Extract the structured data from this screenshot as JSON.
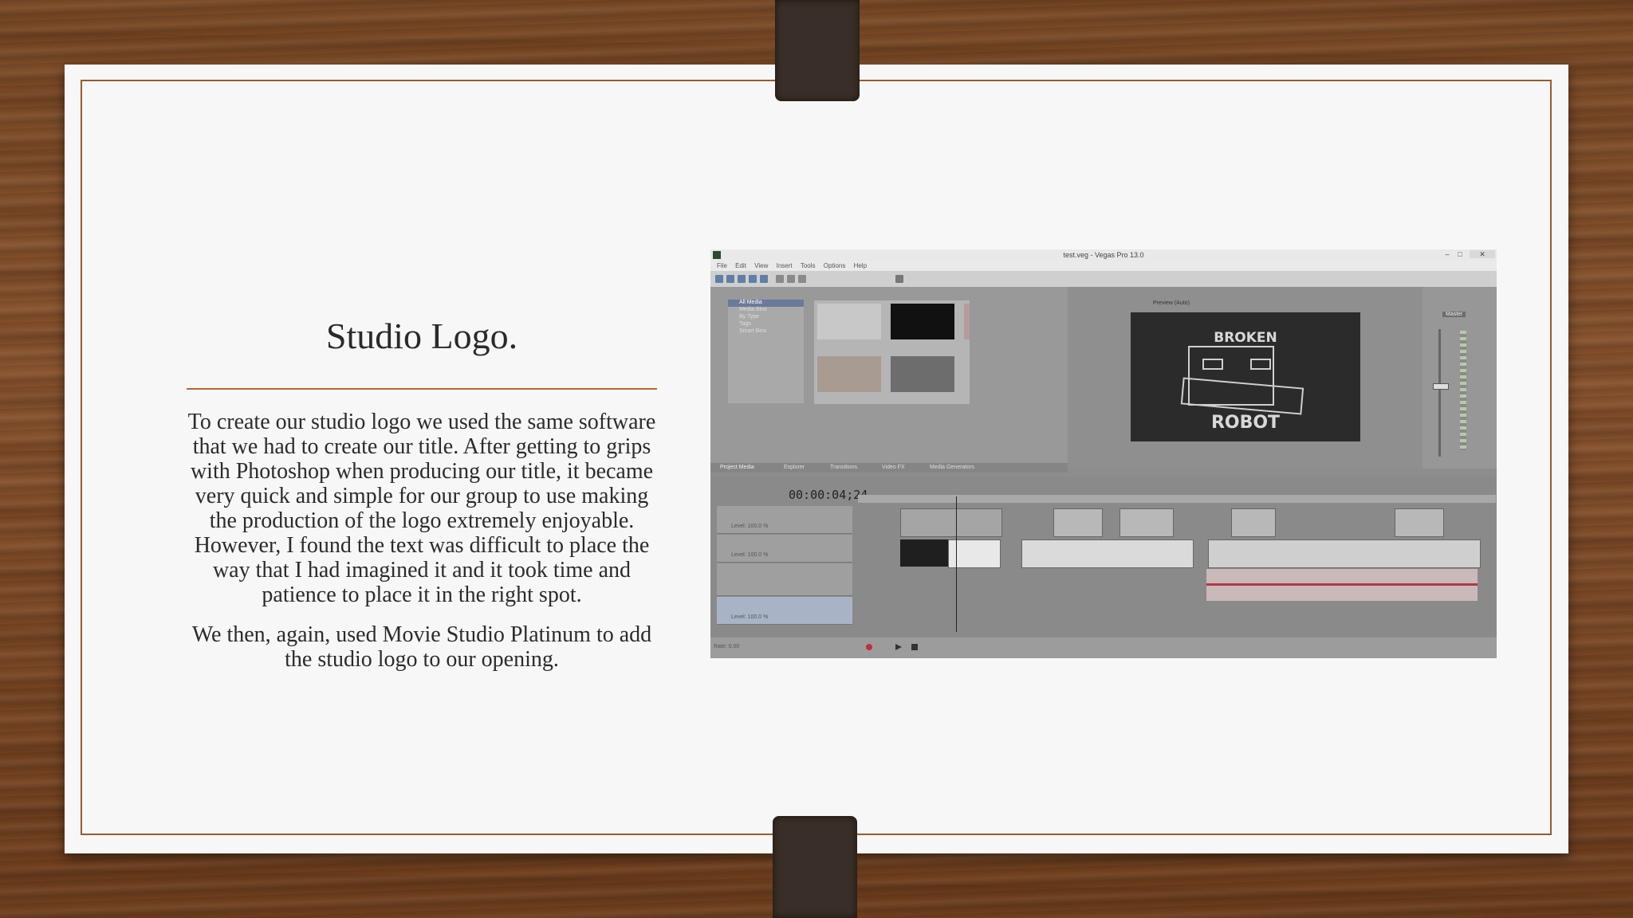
{
  "slide": {
    "title": "Studio Logo.",
    "paragraphs": [
      "To create our studio logo we used the same software that we had to create our title. After getting to grips with Photoshop when producing our title, it became very quick and simple for our group to use making the production of  the logo extremely enjoyable. However, I found the text was difficult to place the way that I had imagined it and it took time and patience to place it in the right spot.",
      "We then, again, used Movie Studio Platinum to add the studio logo to our opening."
    ]
  },
  "screenshot": {
    "window_title": "test.veg - Vegas Pro 13.0",
    "menu": [
      "File",
      "Edit",
      "View",
      "Insert",
      "Tools",
      "Options",
      "Help"
    ],
    "tree_items": [
      "All Media",
      "Media Bins",
      "By Type",
      "Tags",
      "Smart Bins"
    ],
    "preview_label": "Preview (Auto)",
    "preview_logo_top": "BROKEN",
    "preview_logo_bottom": "ROBOT",
    "tabs": [
      "Project Media",
      "Explorer",
      "Transitions",
      "Video FX",
      "Media Generators"
    ],
    "timecode": "00:00:04;24",
    "master_label": "Master",
    "track_level": "Level: 100.0 %",
    "rate_label": "Rate: 0.00"
  },
  "colors": {
    "accent": "#b8652f",
    "paper": "#f7f7f7",
    "strap": "#3a2f28"
  }
}
